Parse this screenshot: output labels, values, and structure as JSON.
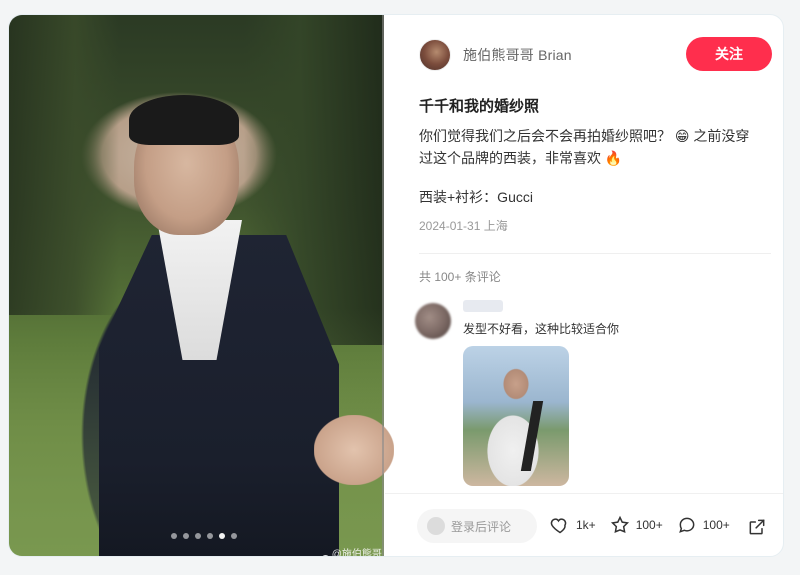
{
  "author": {
    "name": "施伯熊哥哥 Brian",
    "follow_label": "关注"
  },
  "post": {
    "title": "千千和我的婚纱照",
    "desc_line1": "你们觉得我们之后会不会再拍婚纱照吧？",
    "desc_emoji1": "😁",
    "desc_line1b": " 之前没穿",
    "desc_line2": "过这个品牌的西装，非常喜欢",
    "desc_emoji2": "🔥",
    "detail": "西装+衬衫：Gucci",
    "meta": "2024-01-31 上海"
  },
  "comments": {
    "count_label": "共 100+ 条评论",
    "items": [
      {
        "text": "发型不好看，这种比较适合你"
      }
    ]
  },
  "footer": {
    "comment_placeholder": "登录后评论",
    "likes": "1k+",
    "stars": "100+",
    "comments": "100+"
  },
  "media": {
    "watermark": "@施伯熊哥哥"
  },
  "colors": {
    "accent": "#ff2e4d"
  },
  "icons": {
    "heart": "heart-icon",
    "star": "star-icon",
    "comment": "comment-icon",
    "share": "share-icon",
    "weibo": "weibo-icon"
  }
}
